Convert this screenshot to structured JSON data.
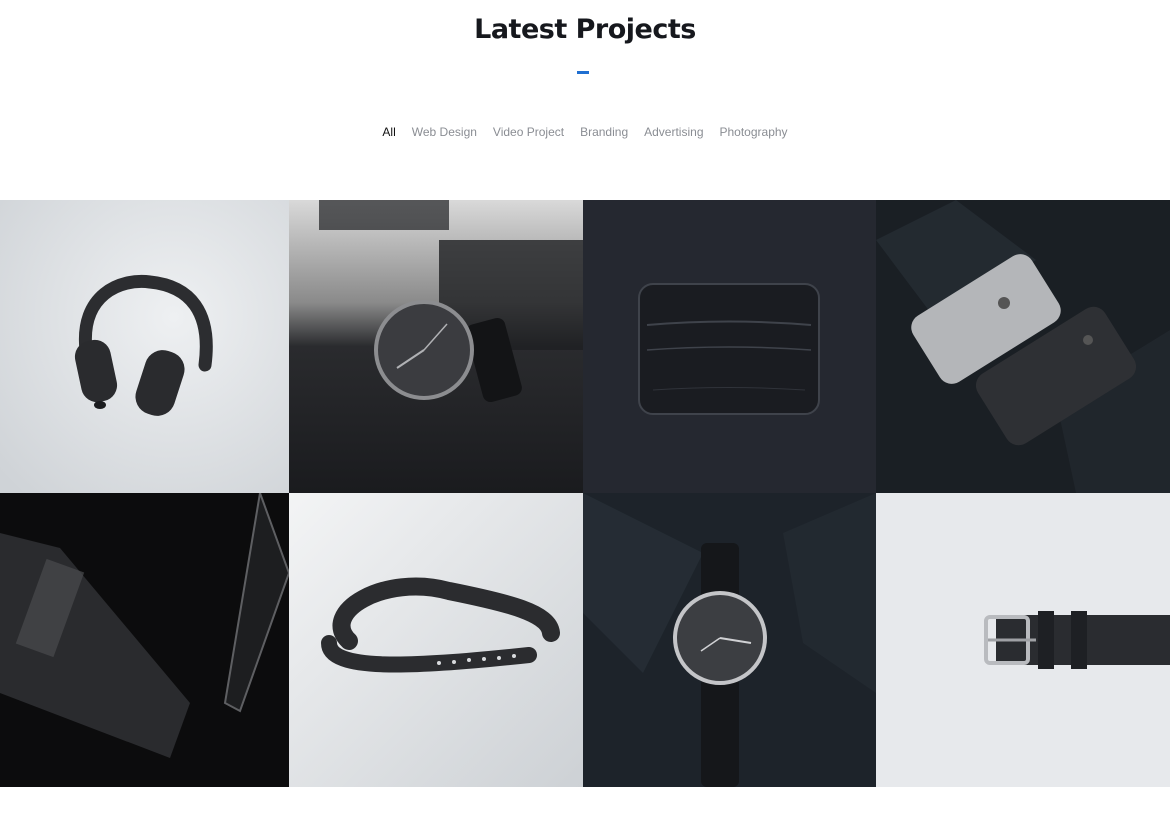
{
  "section": {
    "title": "Latest Projects",
    "accent_color": "#1f6fd1"
  },
  "filters": [
    {
      "label": "All",
      "active": true
    },
    {
      "label": "Web Design",
      "active": false
    },
    {
      "label": "Video Project",
      "active": false
    },
    {
      "label": "Branding",
      "active": false
    },
    {
      "label": "Advertising",
      "active": false
    },
    {
      "label": "Photography",
      "active": false
    }
  ],
  "projects": [
    {
      "subject": "headphones-photo",
      "background": "light"
    },
    {
      "subject": "wristwatch-photo",
      "background": "dark"
    },
    {
      "subject": "leather-card-wallet-photo",
      "background": "dark"
    },
    {
      "subject": "smartphones-photo",
      "background": "dark"
    },
    {
      "subject": "phone-cases-photo",
      "background": "black"
    },
    {
      "subject": "watch-strap-band-photo",
      "background": "light"
    },
    {
      "subject": "wristwatch-on-paper-photo",
      "background": "dark"
    },
    {
      "subject": "leather-belt-buckle-photo",
      "background": "light"
    }
  ]
}
